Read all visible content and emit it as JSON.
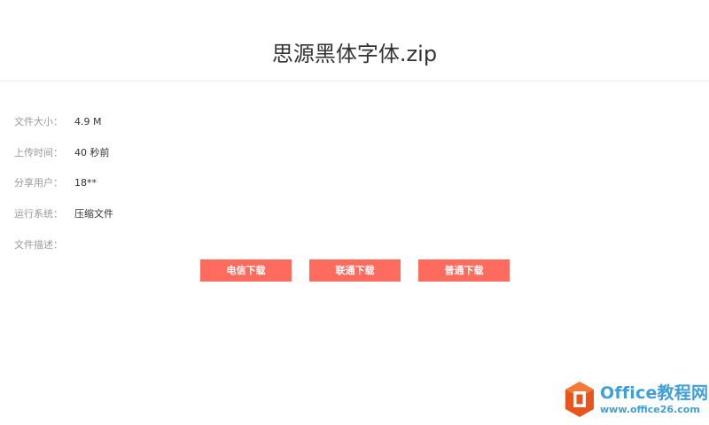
{
  "header": {
    "title": "思源黑体字体.zip"
  },
  "info": {
    "rows": [
      {
        "label": "文件大小：",
        "value": "4.9 M"
      },
      {
        "label": "上传时间：",
        "value": "40 秒前"
      },
      {
        "label": "分享用户：",
        "value": "18**"
      },
      {
        "label": "运行系统：",
        "value": "压缩文件"
      },
      {
        "label": "文件描述：",
        "value": ""
      }
    ]
  },
  "buttons": {
    "telecom": "电信下载",
    "unicom": "联通下载",
    "normal": "普通下载"
  },
  "colors": {
    "accent": "#ff6b5c",
    "watermark": "#3f9fd6",
    "logo_orange": "#e8541c"
  },
  "watermark": {
    "title": "Office教程网",
    "url": "www.office26.com",
    "logo_icon": "office-logo-icon"
  }
}
